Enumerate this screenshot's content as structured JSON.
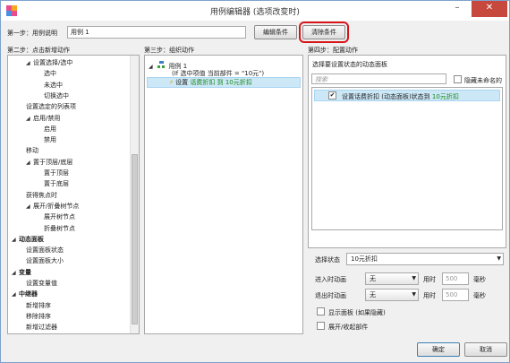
{
  "window": {
    "title": "用例编辑器 (选项改变时)"
  },
  "step1": {
    "label": "第一步：用例说明",
    "case_name": "用例 1",
    "edit_conditions": "编辑条件",
    "clear_conditions": "清除条件"
  },
  "step2": {
    "label": "第二步：点击新增动作",
    "items": [
      {
        "text": "设置选择/选中",
        "expander": "◢"
      },
      {
        "text": "选中",
        "expander": ""
      },
      {
        "text": "未选中",
        "expander": ""
      },
      {
        "text": "切换选中",
        "expander": ""
      },
      {
        "text": "设置选定的列表项",
        "expander": ""
      },
      {
        "text": "启用/禁用",
        "expander": "◢"
      },
      {
        "text": "启用",
        "expander": ""
      },
      {
        "text": "禁用",
        "expander": ""
      },
      {
        "text": "移动",
        "expander": ""
      },
      {
        "text": "置于顶层/底层",
        "expander": "◢"
      },
      {
        "text": "置于顶层",
        "expander": ""
      },
      {
        "text": "置于底层",
        "expander": ""
      },
      {
        "text": "获得焦点时",
        "expander": ""
      },
      {
        "text": "展开/折叠树节点",
        "expander": "◢"
      },
      {
        "text": "展开树节点",
        "expander": ""
      },
      {
        "text": "折叠树节点",
        "expander": ""
      },
      {
        "text": "动态面板",
        "expander": "◢"
      },
      {
        "text": "设置面板状态",
        "expander": ""
      },
      {
        "text": "设置面板大小",
        "expander": ""
      },
      {
        "text": "变量",
        "expander": "◢"
      },
      {
        "text": "设置变量值",
        "expander": ""
      },
      {
        "text": "中继器",
        "expander": "◢"
      },
      {
        "text": "新增排序",
        "expander": ""
      },
      {
        "text": "移除排序",
        "expander": ""
      },
      {
        "text": "新增过滤器",
        "expander": ""
      }
    ]
  },
  "step3": {
    "label": "第三步：组织动作",
    "case_title": "用例 1",
    "case_condition": "(If 选中项值 当前部件 = \"10元\")",
    "action_prefix": "设置 ",
    "action_text": "话费折扣 到 10元折扣"
  },
  "step4": {
    "label": "第四步：配置动作",
    "select_panel_label": "选择要设置状态的动态面板",
    "search_placeholder": "搜索",
    "hide_unnamed": "隐藏未命名的",
    "panel_item": "设置话费折扣 (动态面板)状态到 ",
    "panel_item_value": "10元折扣",
    "select_state_label": "选择状态",
    "select_state_value": "10元折扣",
    "enter_anim_label": "进入时动画",
    "exit_anim_label": "退出时动画",
    "anim_none": "无",
    "duration_label": "用时",
    "duration_value": "500",
    "ms_label": "毫秒",
    "show_panel": "显示面板 (如果隐藏)",
    "push_pull": "展开/收起部件"
  },
  "footer": {
    "ok": "确定",
    "cancel": "取消"
  }
}
